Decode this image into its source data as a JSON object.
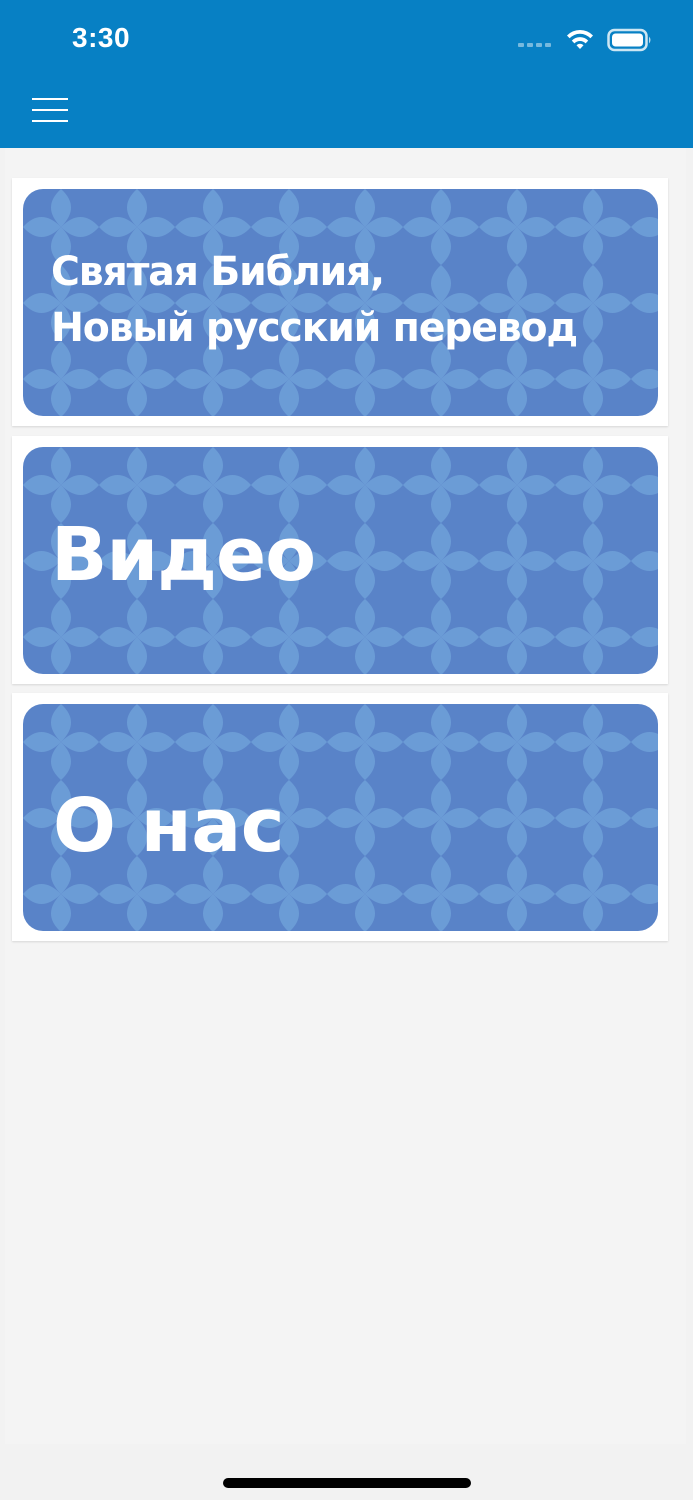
{
  "status_bar": {
    "time": "3:30"
  },
  "app_bar": {
    "menu_icon": "hamburger-menu-icon",
    "background_color": "#0780c4"
  },
  "cards": [
    {
      "title_line1": "Святая Библия,",
      "title_line2": "Новый русский перевод"
    },
    {
      "title": "Видео"
    },
    {
      "title": "О нас"
    }
  ],
  "colors": {
    "card_base": "#5983c8",
    "card_pattern": "#6e9fd8",
    "content_background": "#f4f4f4"
  }
}
